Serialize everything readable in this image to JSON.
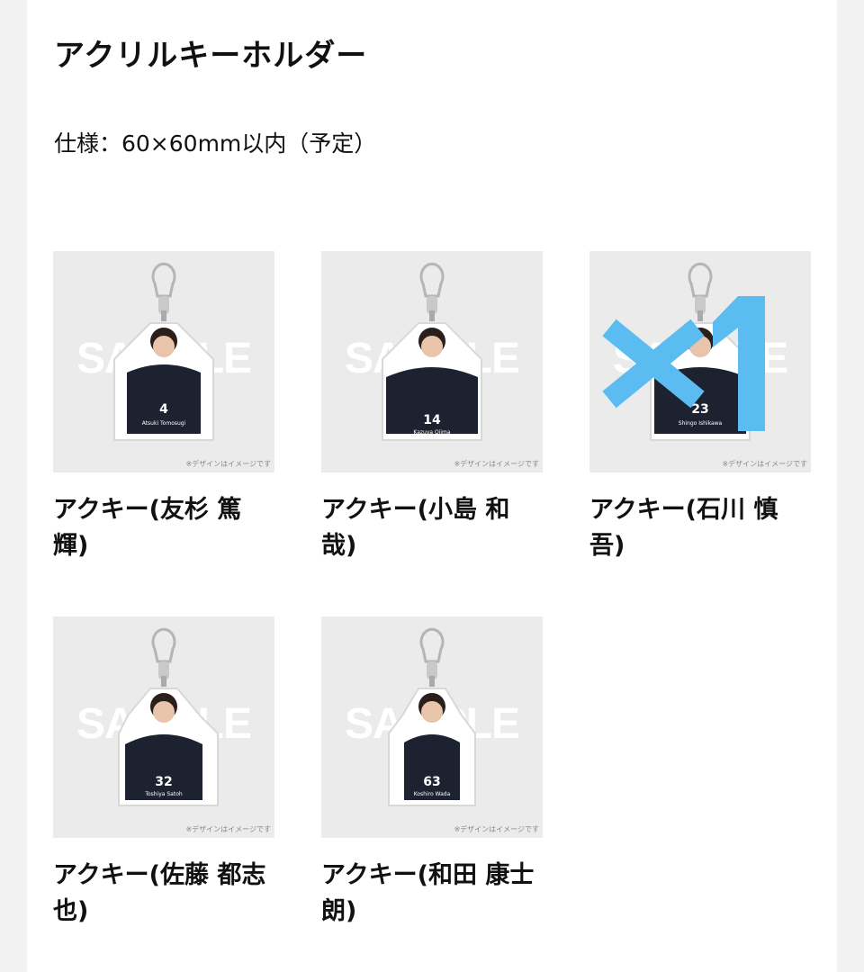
{
  "header": {
    "title": "アクリルキーホルダー",
    "spec": "仕様：60×60mm以内（予定）"
  },
  "products": [
    {
      "name": "アクキー(友杉 篤輝)",
      "number": "4",
      "player": "Atsuki Tomosugi",
      "sample": "SAMPLE",
      "caption": "※デザインはイメージです"
    },
    {
      "name": "アクキー(小島 和哉)",
      "number": "14",
      "player": "Kazuya Ojima",
      "sample": "SAMPLE",
      "caption": "※デザインはイメージです"
    },
    {
      "name": "アクキー(石川 慎吾)",
      "number": "23",
      "player": "Shingo Ishikawa",
      "sample": "SAMPLE",
      "caption": "※デザインはイメージです",
      "soldout_mark": "×1"
    },
    {
      "name": "アクキー(佐藤 都志也)",
      "number": "32",
      "player": "Toshiya Satoh",
      "sample": "SAMPLE",
      "caption": "※デザインはイメージです"
    },
    {
      "name": "アクキー(和田 康士朗)",
      "number": "63",
      "player": "Koshiro Wada",
      "sample": "SAMPLE",
      "caption": "※デザインはイメージです"
    }
  ],
  "colors": {
    "background": "#f2f2f2",
    "card_bg": "#ebebeb",
    "shirt": "#1c2230",
    "soldout_mark": "#5bbcf2"
  }
}
